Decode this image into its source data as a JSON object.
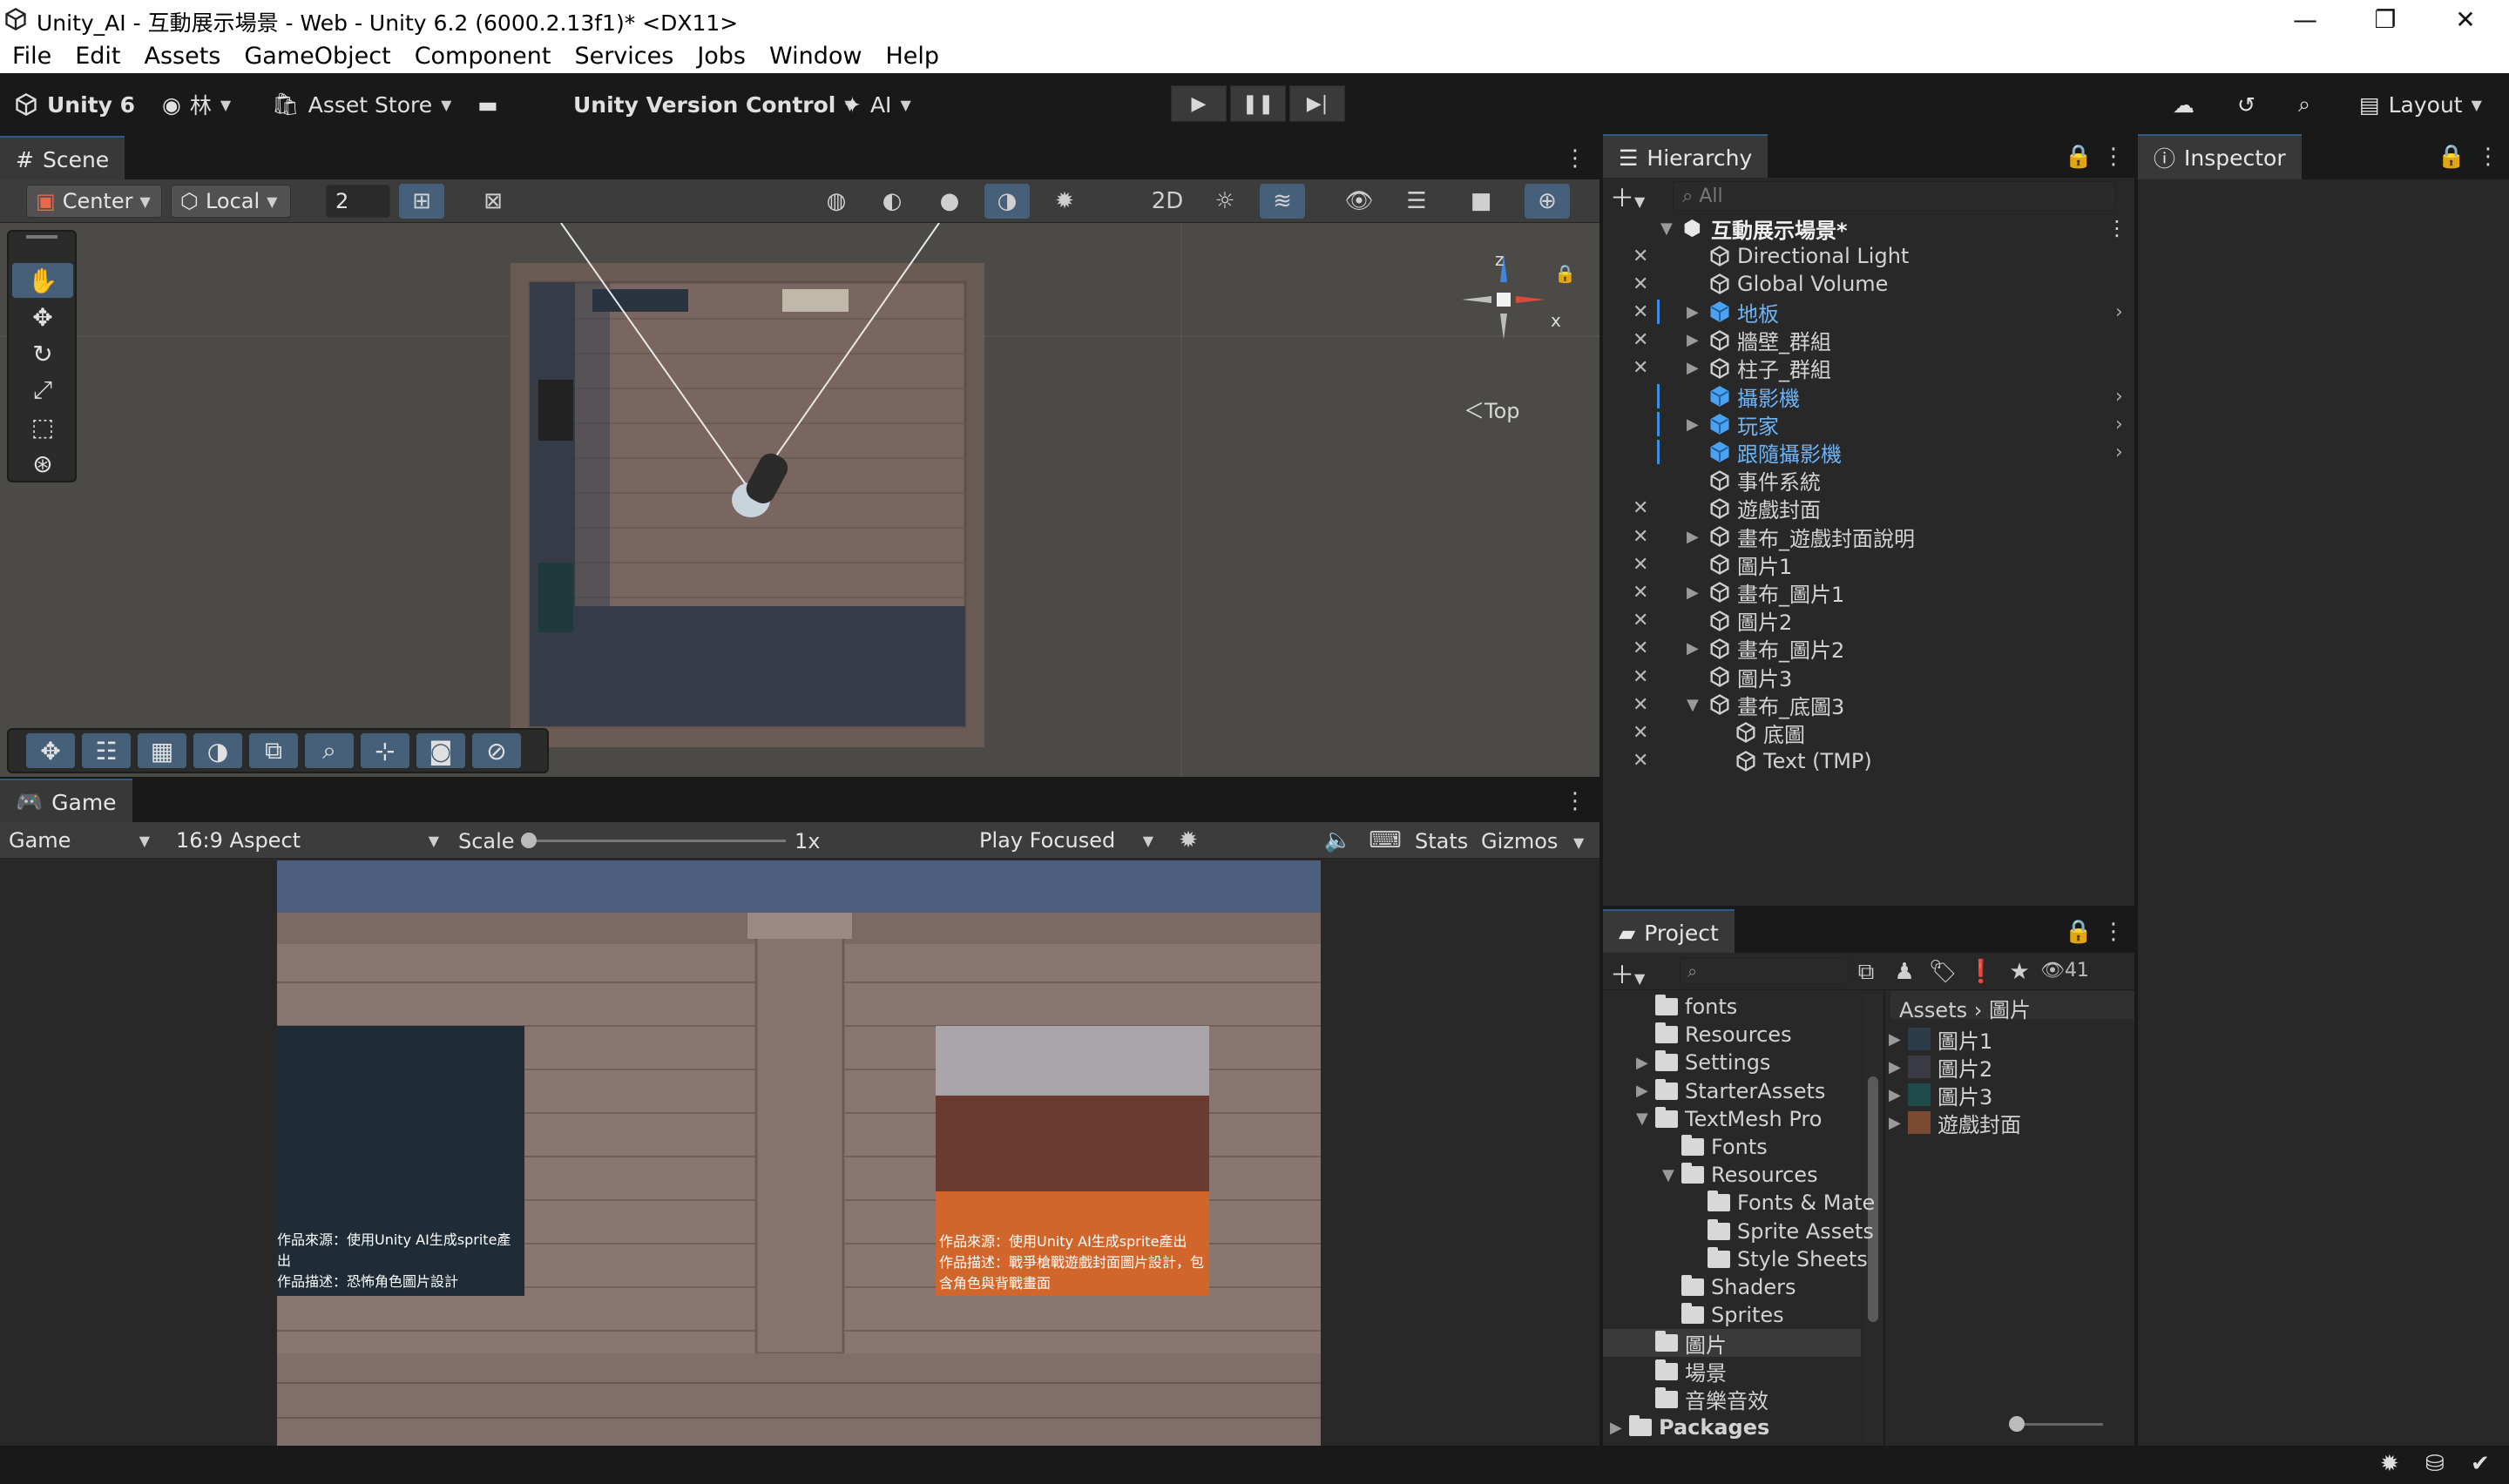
{
  "window": {
    "title": "Unity_AI - 互動展示場景 - Web - Unity 6.2 (6000.2.13f1)* <DX11>"
  },
  "menu": [
    "File",
    "Edit",
    "Assets",
    "GameObject",
    "Component",
    "Services",
    "Jobs",
    "Window",
    "Help"
  ],
  "toolbar": {
    "unity_label": "Unity 6",
    "account_label": "林",
    "asset_store_label": "Asset Store",
    "version_control_label": "Unity Version Control",
    "ai_label": "AI",
    "layout_label": "Layout"
  },
  "scene": {
    "tab_label": "Scene",
    "pivot_label": "Center",
    "space_label": "Local",
    "grid_value": "2",
    "gizmo_view_label": "Top",
    "axis_labels": {
      "x": "x",
      "z": "z"
    }
  },
  "game": {
    "tab_label": "Game",
    "display_label": "Game",
    "aspect_label": "16:9 Aspect",
    "scale_label": "Scale",
    "scale_value": "1x",
    "play_mode_label": "Play Focused",
    "stats_label": "Stats",
    "gizmos_label": "Gizmos",
    "poster_left_text": [
      "作品來源：使用Unity AI生成sprite產出",
      "作品描述：恐怖角色圖片設計"
    ],
    "poster_right_text": [
      "作品來源：使用Unity AI生成sprite產出",
      "作品描述：戰爭槍戰遊戲封面圖片設計，包",
      "含角色與背戰畫面"
    ]
  },
  "hierarchy": {
    "tab_label": "Hierarchy",
    "search_placeholder": "All",
    "scene_name": "互動展示場景*",
    "items": [
      {
        "label": "Directional Light",
        "blue": false,
        "expand": ""
      },
      {
        "label": "Global Volume",
        "blue": false,
        "expand": ""
      },
      {
        "label": "地板",
        "blue": true,
        "expand": "▶"
      },
      {
        "label": "牆壁_群組",
        "blue": false,
        "expand": "▶"
      },
      {
        "label": "柱子_群組",
        "blue": false,
        "expand": "▶"
      },
      {
        "label": "攝影機",
        "blue": true,
        "expand": ""
      },
      {
        "label": "玩家",
        "blue": true,
        "expand": "▶"
      },
      {
        "label": "跟隨攝影機",
        "blue": true,
        "expand": ""
      },
      {
        "label": "事件系統",
        "blue": false,
        "expand": ""
      },
      {
        "label": "遊戲封面",
        "blue": false,
        "expand": ""
      },
      {
        "label": "畫布_遊戲封面說明",
        "blue": false,
        "expand": "▶"
      },
      {
        "label": "圖片1",
        "blue": false,
        "expand": ""
      },
      {
        "label": "畫布_圖片1",
        "blue": false,
        "expand": "▶"
      },
      {
        "label": "圖片2",
        "blue": false,
        "expand": ""
      },
      {
        "label": "畫布_圖片2",
        "blue": false,
        "expand": "▶"
      },
      {
        "label": "圖片3",
        "blue": false,
        "expand": ""
      },
      {
        "label": "畫布_底圖3",
        "blue": false,
        "expand": "▼"
      },
      {
        "label": "底圖",
        "blue": false,
        "expand": ""
      },
      {
        "label": "Text (TMP)",
        "blue": false,
        "expand": ""
      }
    ]
  },
  "inspector": {
    "tab_label": "Inspector"
  },
  "project": {
    "tab_label": "Project",
    "hidden_count": "41",
    "breadcrumb": [
      "Assets",
      "圖片"
    ],
    "tree": [
      {
        "label": "fonts",
        "arrow": ""
      },
      {
        "label": "Resources",
        "arrow": ""
      },
      {
        "label": "Settings",
        "arrow": "▶"
      },
      {
        "label": "StarterAssets",
        "arrow": "▶"
      },
      {
        "label": "TextMesh Pro",
        "arrow": "▼"
      },
      {
        "label": "Fonts",
        "arrow": ""
      },
      {
        "label": "Resources",
        "arrow": "▼"
      },
      {
        "label": "Fonts & Mate",
        "arrow": ""
      },
      {
        "label": "Sprite Assets",
        "arrow": ""
      },
      {
        "label": "Style Sheets",
        "arrow": ""
      },
      {
        "label": "Shaders",
        "arrow": ""
      },
      {
        "label": "Sprites",
        "arrow": ""
      },
      {
        "label": "圖片",
        "arrow": ""
      },
      {
        "label": "場景",
        "arrow": ""
      },
      {
        "label": "音樂音效",
        "arrow": ""
      },
      {
        "label": "Packages",
        "arrow": "▶"
      }
    ],
    "assets": [
      "圖片1",
      "圖片2",
      "圖片3",
      "遊戲封面"
    ]
  }
}
